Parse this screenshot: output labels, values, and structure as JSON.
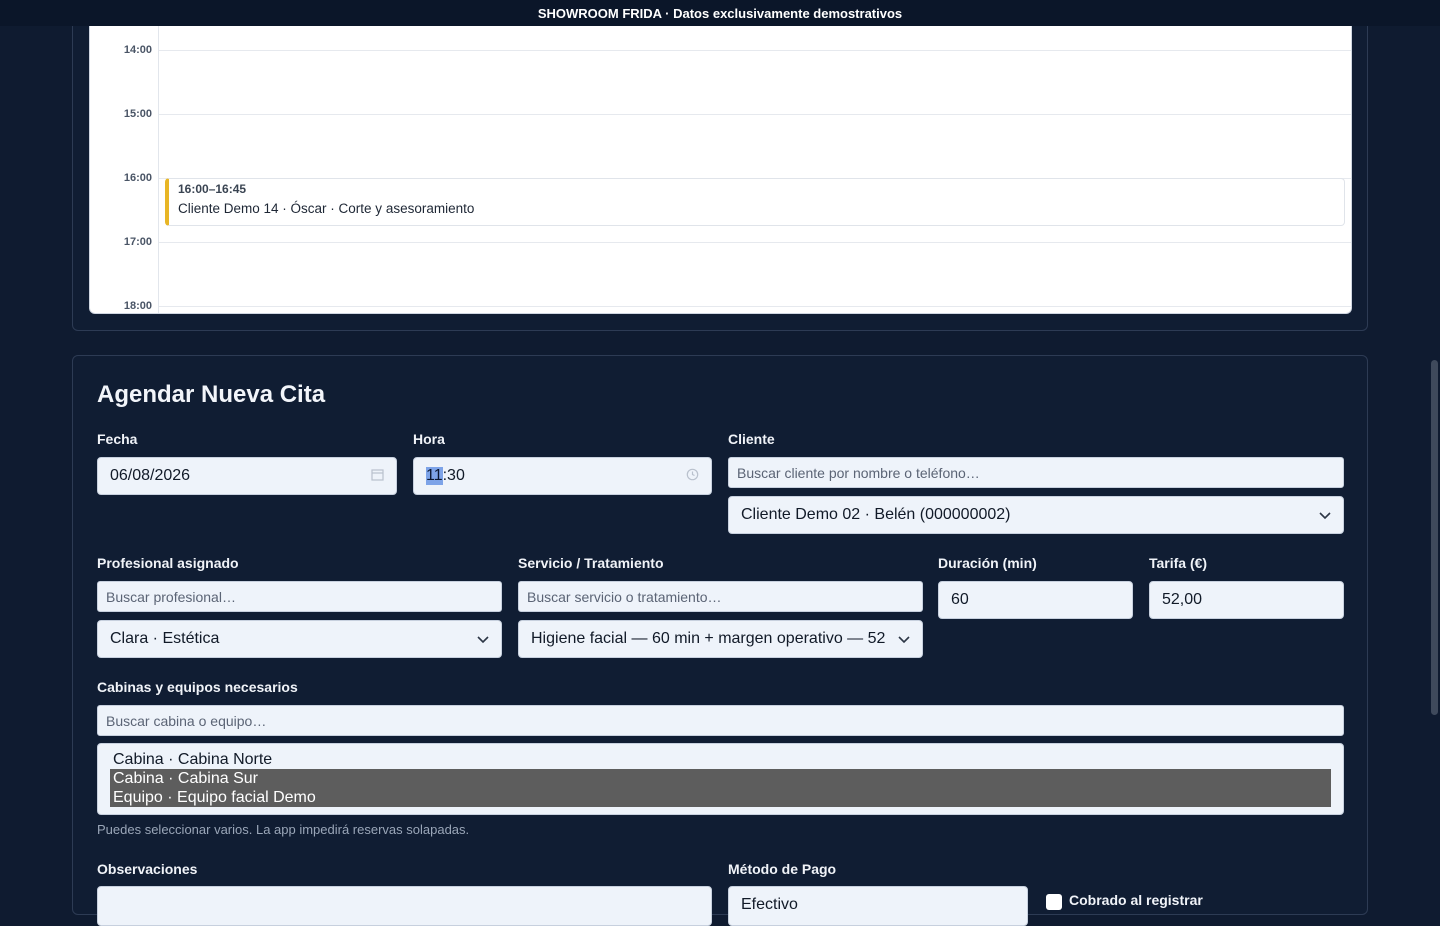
{
  "banner": "SHOWROOM FRIDA · Datos exclusivamente demostrativos",
  "calendar": {
    "slots": [
      "14:00",
      "15:00",
      "16:00",
      "17:00",
      "18:00"
    ],
    "event": {
      "time": "16:00–16:45",
      "title": "Cliente Demo 14 · Óscar · Corte y asesoramiento",
      "color": "#e8b626"
    }
  },
  "form": {
    "title": "Agendar Nueva Cita",
    "fecha": {
      "label": "Fecha",
      "value": "06/08/2026"
    },
    "hora": {
      "label": "Hora",
      "value_hl": "11",
      "value_rest": ":30"
    },
    "cliente": {
      "label": "Cliente",
      "search_placeholder": "Buscar cliente por nombre o teléfono…",
      "selected": "Cliente Demo 02 · Belén (000000002)"
    },
    "profesional": {
      "label": "Profesional asignado",
      "search_placeholder": "Buscar profesional…",
      "selected": "Clara · Estética"
    },
    "servicio": {
      "label": "Servicio / Tratamiento",
      "search_placeholder": "Buscar servicio o tratamiento…",
      "selected": "Higiene facial — 60 min + margen operativo — 52"
    },
    "duracion": {
      "label": "Duración (min)",
      "value": "60"
    },
    "tarifa": {
      "label": "Tarifa (€)",
      "value": "52,00"
    },
    "cabinas": {
      "label": "Cabinas y equipos necesarios",
      "search_placeholder": "Buscar cabina o equipo…",
      "options": [
        "Cabina · Cabina Norte",
        "Cabina · Cabina Sur",
        "Equipo · Equipo facial Demo"
      ],
      "selected": [
        "Cabina · Cabina Sur",
        "Equipo · Equipo facial Demo"
      ],
      "help": "Puedes seleccionar varios. La app impedirá reservas solapadas."
    },
    "observaciones": {
      "label": "Observaciones"
    },
    "metodo_pago": {
      "label": "Método de Pago",
      "selected": "Efectivo"
    },
    "cobrado": {
      "label": "Cobrado al registrar"
    }
  },
  "icons": {
    "calendar": "calendar-icon",
    "clock": "clock-icon",
    "chevron": "chevron-down-icon"
  }
}
